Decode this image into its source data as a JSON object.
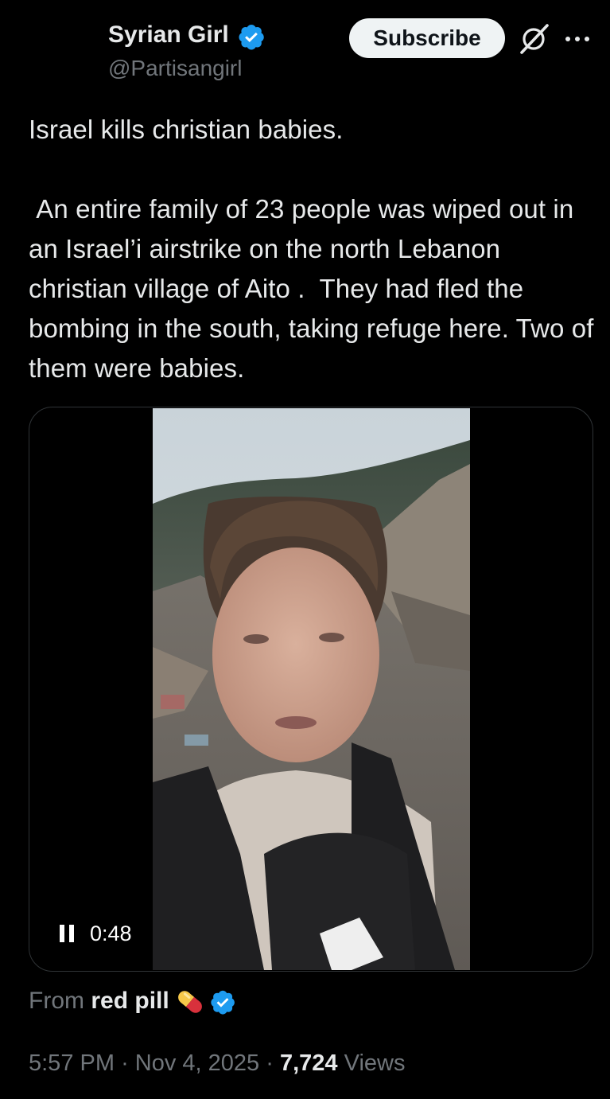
{
  "colors": {
    "background": "#000000",
    "text_primary": "#e7e9ea",
    "text_secondary": "#71767b",
    "verified_blue": "#1d9bf0",
    "subscribe_bg": "#eff3f4",
    "card_border": "#2f3336"
  },
  "author": {
    "display_name": "Syrian Girl",
    "handle": "@Partisangirl",
    "verified": true,
    "badge_icon": "verified-badge-icon"
  },
  "header": {
    "subscribe_label": "Subscribe",
    "grok_icon": "grok-icon",
    "more_icon": "more-options-icon"
  },
  "tweet": {
    "text": "Israel kills christian babies.\n\n An entire family of 23 people was wiped out in an Israel’i airstrike on the north Lebanon christian village of Aito .  They had fled the bombing in the south, taking refuge here. Two of them were babies."
  },
  "media": {
    "type": "video",
    "state": "playing",
    "control_icon": "pause-icon",
    "time_label": "0:48"
  },
  "source": {
    "prefix": "From",
    "name": "red pill",
    "emoji_icon": "pill-icon",
    "verified": true
  },
  "meta": {
    "time": "5:57 PM",
    "separator": "·",
    "date": "Nov 4, 2025",
    "views_count": "7,724",
    "views_label": "Views"
  }
}
